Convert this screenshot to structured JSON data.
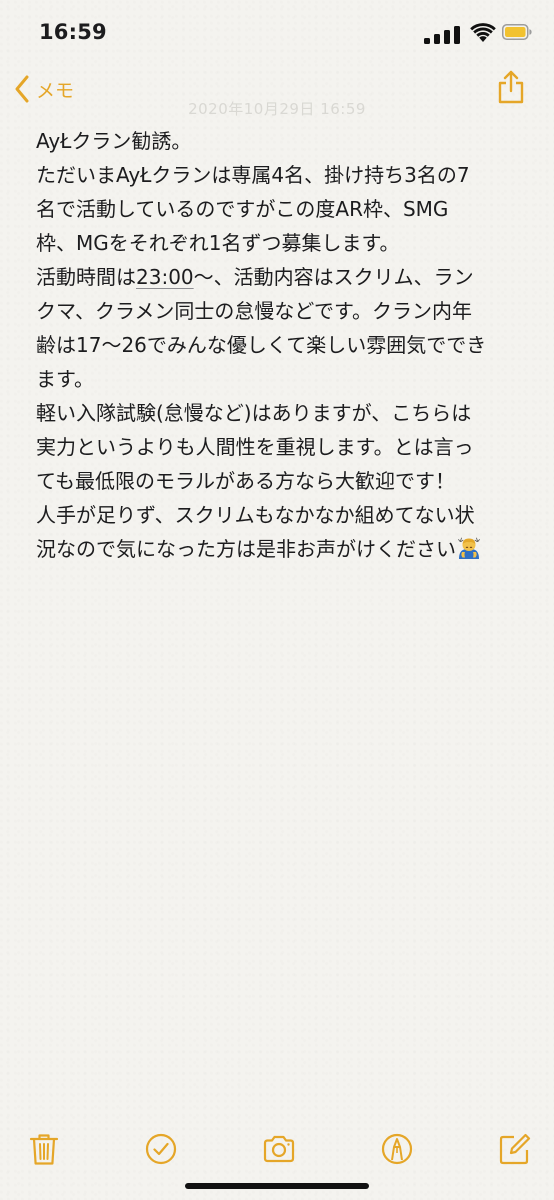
{
  "status_bar": {
    "time": "16:59"
  },
  "nav": {
    "back_label": "メモ",
    "date_text": "2020年10月29日 16:59"
  },
  "note": {
    "line_01": "AyŁクラン勧誘。",
    "line_02": "ただいまAyŁクランは専属4名、掛け持ち3名の7",
    "line_03": "名で活動しているのですがこの度AR枠、SMG",
    "line_04": "枠、MGをそれぞれ1名ずつ募集します。",
    "line_05_pre": "活動時間は",
    "line_05_time": "23:00",
    "line_05_post": "〜、活動内容はスクリム、ラン",
    "line_06": "クマ、クラメン同士の怠慢などです。クラン内年",
    "line_07": "齢は17〜26でみんな優しくて楽しい雰囲気ででき",
    "line_08": "ます。",
    "line_09": "軽い入隊試験(怠慢など)はありますが、こちらは",
    "line_10": "実力というよりも人間性を重視します。とは言っ",
    "line_11": "ても最低限のモラルがある方なら大歓迎です！",
    "line_12": "人手が足りず、スクリムもなかなか組めてない状",
    "line_13": "況なので気になった方は是非お声がけください"
  },
  "colors": {
    "accent": "#e5a628",
    "text": "#1c1c1e",
    "paper": "#f4f3ef"
  },
  "icons": {
    "back": "chevron-left-icon",
    "share": "share-icon",
    "emoji": "person-bowing-emoji",
    "toolbar": [
      "trash-icon",
      "checklist-icon",
      "camera-icon",
      "markup-pen-icon",
      "compose-icon"
    ]
  }
}
